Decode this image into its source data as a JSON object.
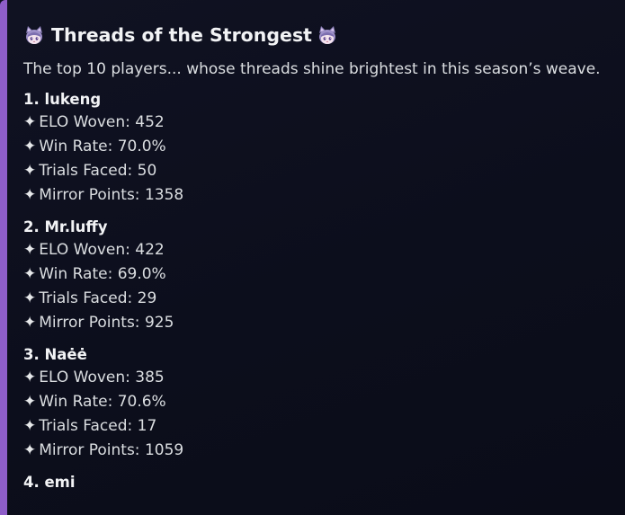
{
  "embed": {
    "title": "Threads of the Strongest",
    "title_emote": "cat-girl-emote-icon",
    "description": "The top 10 players... whose threads shine brightest in this season’s weave.",
    "accent_color": "#8e5ec9",
    "stat_bullet": "✦",
    "stat_labels": {
      "elo": "ELO Woven:",
      "winrate": "Win Rate:",
      "trials": "Trials Faced:",
      "mirror": "Mirror Points:"
    },
    "players": [
      {
        "name": "1. lukeng",
        "elo": "452",
        "winrate": "70.0%",
        "trials": "50",
        "mirror": "1358"
      },
      {
        "name": "2. Mr.luffy",
        "elo": "422",
        "winrate": "69.0%",
        "trials": "29",
        "mirror": "925"
      },
      {
        "name": "3. Naėė",
        "elo": "385",
        "winrate": "70.6%",
        "trials": "17",
        "mirror": "1059"
      },
      {
        "name": "4. emi"
      }
    ]
  }
}
